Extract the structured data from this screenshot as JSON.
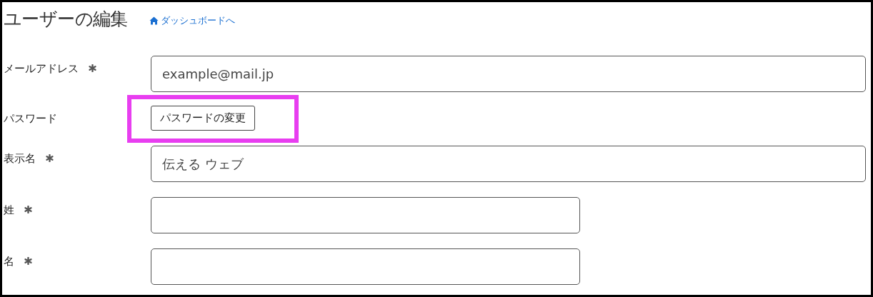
{
  "title": "ユーザーの編集",
  "back_link": {
    "label": "ダッシュボードへ"
  },
  "fields": [
    {
      "label": "メールアドレス",
      "required": true,
      "kind": "wide_input",
      "value": "example@mail.jp",
      "highlighted": false
    },
    {
      "label": "パスワード",
      "required": false,
      "kind": "button",
      "value": "パスワードの変更",
      "highlighted": true
    },
    {
      "label": "表示名",
      "required": true,
      "kind": "wide_input",
      "value": "伝える ウェブ",
      "highlighted": false
    },
    {
      "label": "姓",
      "required": true,
      "kind": "narrow_input",
      "highlighted": false
    },
    {
      "label": "名",
      "required": true,
      "kind": "narrow_input",
      "highlighted": false
    }
  ]
}
